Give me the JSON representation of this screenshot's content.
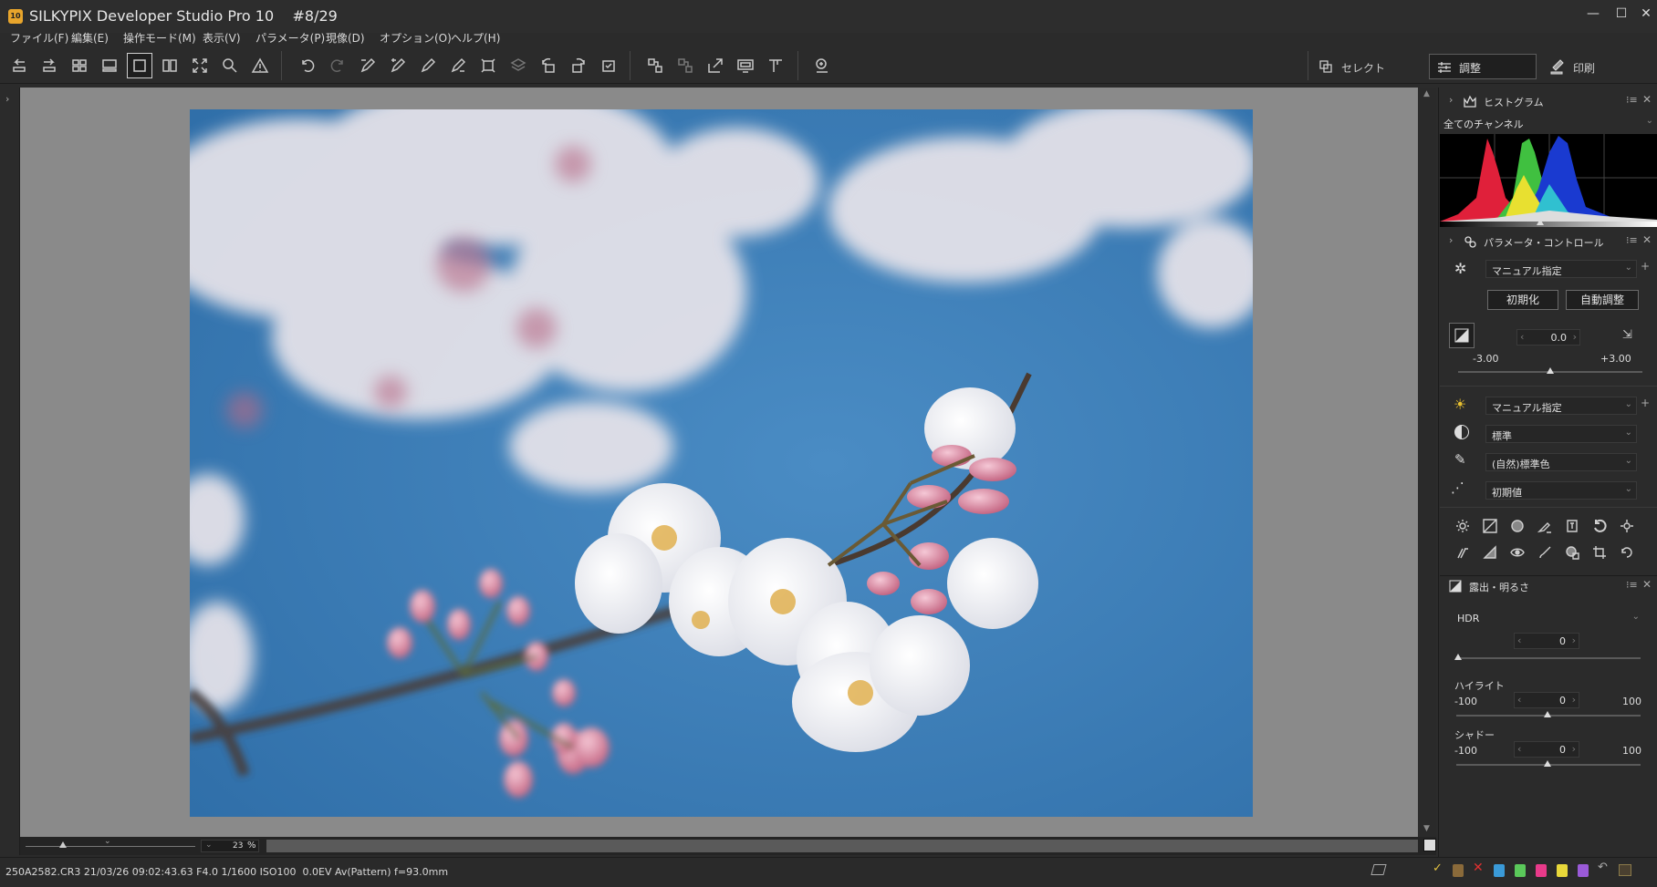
{
  "title": {
    "app_icon": "10",
    "text": "SILKYPIX Developer Studio Pro 10    #8/29",
    "min": "—",
    "max": "☐",
    "close": "✕"
  },
  "menu": [
    "ファイル(F)",
    "編集(E)",
    "操作モード(M)",
    "表示(V)",
    "パラメータ(P)",
    "現像(D)",
    "オプション(O)",
    "ヘルプ(H)"
  ],
  "modes": {
    "select": "セレクト",
    "adjust": "調整",
    "print": "印刷"
  },
  "histogram": {
    "title": "ヒストグラム",
    "channel": "全てのチャンネル"
  },
  "param_control": {
    "title": "パラメータ・コントロール",
    "taste": "マニュアル指定",
    "reset_label": "初期化",
    "auto_label": "自動調整",
    "exposure_value": "0.0",
    "exposure_min": "-3.00",
    "exposure_max": "+3.00",
    "exposure_level": 0.5,
    "wb": "マニュアル指定",
    "tone": "標準",
    "color": "(自然)標準色",
    "sharp": "初期値"
  },
  "exposure_panel": {
    "title": "露出・明るさ",
    "hdr_label": "HDR",
    "hdr_value": "0",
    "highlight_label": "ハイライト",
    "highlight_min": "-100",
    "highlight_max": "100",
    "highlight_value": "0",
    "shadow_label": "シャドー",
    "shadow_min": "-100",
    "shadow_max": "100",
    "shadow_value": "0"
  },
  "viewbar": {
    "zoom": "23",
    "zoom_unit": "%"
  },
  "status": {
    "info": "250A2582.CR3 21/03/26 09:02:43.63 F4.0 1/1600 ISO100  0.0EV Av(Pattern) f=93.0mm"
  },
  "colors": {
    "accent": "#e8a52c",
    "sky": "#3a78b0",
    "viewer_bg": "#8a8a8a"
  }
}
